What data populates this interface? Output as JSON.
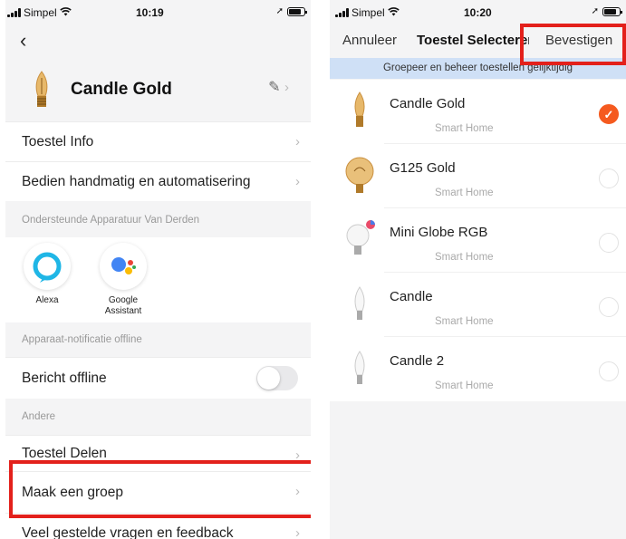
{
  "colors": {
    "accent": "#f55a1f",
    "highlight": "#e3201b",
    "banner": "#cfe0f6",
    "background": "#f4f4f5"
  },
  "left": {
    "status": {
      "carrier": "Simpel",
      "time": "10:19"
    },
    "device_name": "Candle Gold",
    "rows_top": [
      {
        "label": "Toestel Info"
      },
      {
        "label": "Bedien handmatig en automatisering"
      }
    ],
    "section_third_party": "Ondersteunde Apparatuur Van Derden",
    "assistants": [
      {
        "label": "Alexa",
        "icon": "alexa-icon"
      },
      {
        "label": "Google\nAssistant",
        "icon": "google-assistant-icon"
      }
    ],
    "section_offline": "Apparaat-notificatie offline",
    "offline_row": {
      "label": "Bericht offline",
      "enabled": false
    },
    "section_other": "Andere",
    "rows_bottom": [
      {
        "label": "Toestel Delen"
      },
      {
        "label": "Maak een groep"
      },
      {
        "label": "Veel gestelde vragen en feedback"
      }
    ]
  },
  "right": {
    "status": {
      "carrier": "Simpel",
      "time": "10:20"
    },
    "cancel": "Annuleer",
    "title": "Toestel Selecteren",
    "confirm": "Bevestigen",
    "banner": "Groepeer en beheer toestellen gelijktijdig",
    "devices": [
      {
        "name": "Candle Gold",
        "room": "Smart Home",
        "selected": true,
        "icon": "candle-gold-bulb-icon"
      },
      {
        "name": "G125 Gold",
        "room": "Smart Home",
        "selected": false,
        "icon": "globe-gold-bulb-icon"
      },
      {
        "name": "Mini Globe RGB",
        "room": "Smart Home",
        "selected": false,
        "icon": "mini-globe-bulb-icon"
      },
      {
        "name": "Candle",
        "room": "Smart Home",
        "selected": false,
        "icon": "candle-bulb-icon"
      },
      {
        "name": "Candle 2",
        "room": "Smart Home",
        "selected": false,
        "icon": "candle-bulb-icon"
      }
    ]
  }
}
